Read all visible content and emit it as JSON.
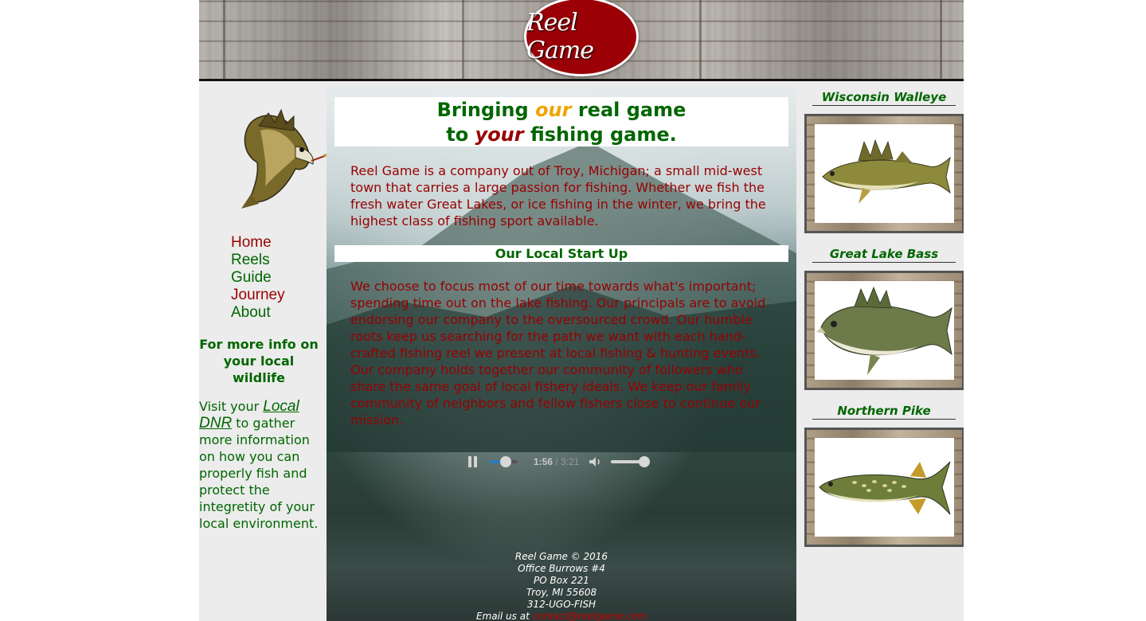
{
  "header": {
    "logo_text": "Reel Game"
  },
  "nav": {
    "items": [
      {
        "label": "Home",
        "color": "#990000"
      },
      {
        "label": "Reels",
        "color": "#006600"
      },
      {
        "label": "Guide",
        "color": "#006600"
      },
      {
        "label": "Journey",
        "color": "#990000"
      },
      {
        "label": "About",
        "color": "#006600"
      }
    ]
  },
  "sidebar": {
    "info_heading": "For more info on your local wildlife",
    "visit_prefix": "Visit your",
    "dnr_link": "Local DNR",
    "visit_suffix": "to gather more information on how you can properly fish and protect the integretity of your local environment."
  },
  "main": {
    "title_line1_a": "Bringing",
    "title_line1_b": "our",
    "title_line1_c": "real game",
    "title_line2_a": "to",
    "title_line2_b": "your",
    "title_line2_c": "fishing game.",
    "intro": "Reel Game is a company out of Troy, Michigan; a small mid-west town that carries a large passion for fishing. Whether we fish the fresh water Great Lakes, or ice fishing in the winter, we bring the highest class of fishing sport available.",
    "subheading": "Our Local Start Up",
    "story": "We choose to focus most of our time towards what's important; spending time out on the lake fishing. Our principals are to avoid endorsing our company to the oversourced crowd. Our humble roots keep us searching for the path we want with each hand-crafted fishing reel we present at local fishing & hunting events. Our company holds together our community of followers who share the same goal of local fishery ideals. We keep our family community of neighbors and fellow fishers close to continue our mission."
  },
  "audio": {
    "current_time": "1:56",
    "total_time": "/ 3:21",
    "progress": 0.58,
    "volume": 0.9
  },
  "footer": {
    "line1": "Reel Game © 2016",
    "line2": "Office Burrows #4",
    "line3": "PO Box 221",
    "line4": "Troy, MI 55608",
    "line5": "312-UGO-FISH",
    "email_prefix": "Email us at",
    "email": "contact@reelgame.com"
  },
  "fish": [
    {
      "name": "Wisconsin Walleye",
      "icon": "walleye-image"
    },
    {
      "name": "Great Lake Bass",
      "icon": "bass-image"
    },
    {
      "name": "Northern Pike",
      "icon": "pike-image"
    }
  ],
  "colors": {
    "brand_red": "#990000",
    "brand_green": "#006600",
    "accent_orange": "#f0a500"
  }
}
